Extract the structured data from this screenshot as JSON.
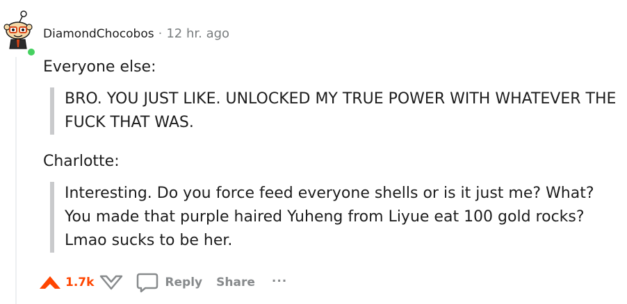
{
  "comment": {
    "username": "DiamondChocobos",
    "separator": "·",
    "timestamp": "12 hr. ago",
    "online": true,
    "paragraphs": {
      "p1": "Everyone else:",
      "q1": "BRO. YOU JUST LIKE. UNLOCKED MY TRUE POWER WITH WHATEVER THE FUCK THAT WAS.",
      "p2": "Charlotte:",
      "q2": "Interesting. Do you force feed everyone shells or is it just me? What? You made that purple haired Yuheng from Liyue eat 100 gold rocks? Lmao sucks to be her."
    }
  },
  "actions": {
    "score": "1.7k",
    "reply_label": "Reply",
    "share_label": "Share",
    "more_label": "...",
    "upvote_icon": "upvote-arrow-icon",
    "downvote_icon": "downvote-arrow-icon",
    "reply_icon": "speech-bubble-icon",
    "upvote_color": "#ff4500",
    "muted_color": "#878a8c"
  },
  "colors": {
    "online": "#46d160",
    "quote_bar": "#c9cacc",
    "thread_line": "#edeff1"
  }
}
